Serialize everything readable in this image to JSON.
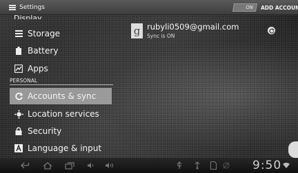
{
  "action_bar": {
    "title": "Settings",
    "toggle_label": "ON",
    "add_account_label": "ADD ACCOUNT"
  },
  "sidebar": {
    "items": [
      {
        "label": "Display",
        "icon": "display-icon"
      },
      {
        "label": "Storage",
        "icon": "storage-icon"
      },
      {
        "label": "Battery",
        "icon": "battery-icon"
      },
      {
        "label": "Apps",
        "icon": "apps-icon"
      }
    ],
    "section_header": "PERSONAL",
    "personal_items": [
      {
        "label": "Accounts & sync",
        "icon": "sync-icon",
        "selected": true
      },
      {
        "label": "Location services",
        "icon": "location-icon"
      },
      {
        "label": "Security",
        "icon": "lock-icon"
      },
      {
        "label": "Language & input",
        "icon": "keyboard-icon"
      }
    ]
  },
  "account": {
    "email": "rubyli0509@gmail.com",
    "status": "Sync is ON"
  },
  "status_bar": {
    "time": "9:50"
  },
  "colors": {
    "selected_item_bg": "#aaaaaa",
    "action_bar_bg": "#4a4a4a"
  }
}
